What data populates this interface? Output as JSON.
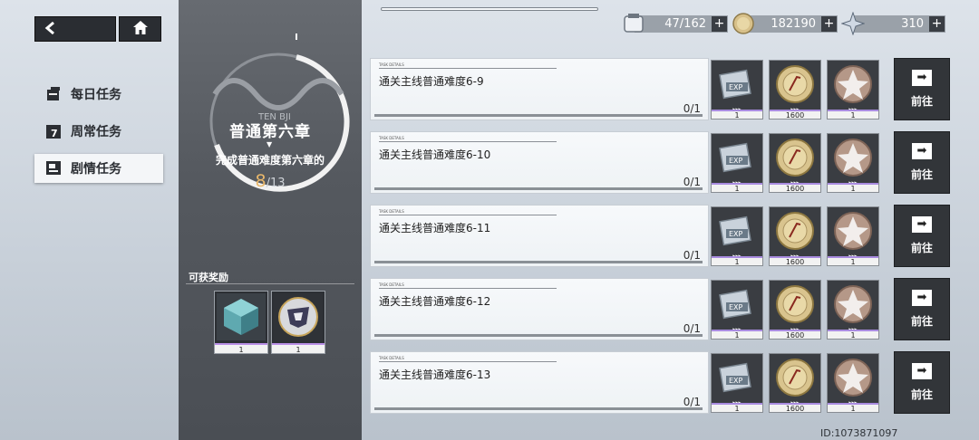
{
  "header": {
    "back_icon": "chevron-left-icon",
    "home_icon": "home-icon"
  },
  "nav": {
    "items": [
      {
        "label": "每日任务",
        "icon": "daily-task-icon",
        "active": false
      },
      {
        "label": "周常任务",
        "icon": "weekly-calendar-icon",
        "active": false
      },
      {
        "label": "剧情任务",
        "icon": "story-task-icon",
        "active": true
      }
    ]
  },
  "chapter": {
    "logo_text": "TEN BJI",
    "title": "普通第六章",
    "description": "完成普通难度第六章的",
    "progress_current": "8",
    "progress_total": "/13",
    "reward_label": "可获奖励",
    "rewards": [
      {
        "icon": "crystal-cube-icon",
        "count": "1"
      },
      {
        "icon": "emblem-badge-icon",
        "count": "1"
      }
    ]
  },
  "resources": [
    {
      "icon": "stamina-icon",
      "value": "47/162"
    },
    {
      "icon": "gold-coin-icon",
      "value": "182190"
    },
    {
      "icon": "star-crystal-icon",
      "value": "310"
    }
  ],
  "tasks": [
    {
      "tag": "TASK DETAILS",
      "name": "通关主线普通难度6-9",
      "progress": "0/1",
      "progress_fraction": 0
    },
    {
      "tag": "TASK DETAILS",
      "name": "通关主线普通难度6-10",
      "progress": "0/1",
      "progress_fraction": 0
    },
    {
      "tag": "TASK DETAILS",
      "name": "通关主线普通难度6-11",
      "progress": "0/1",
      "progress_fraction": 0
    },
    {
      "tag": "TASK DETAILS",
      "name": "通关主线普通难度6-12",
      "progress": "0/1",
      "progress_fraction": 0
    },
    {
      "tag": "TASK DETAILS",
      "name": "通关主线普通难度6-13",
      "progress": "0/1",
      "progress_fraction": 0
    }
  ],
  "task_rewards": [
    {
      "icon": "exp-book-icon",
      "count": "1"
    },
    {
      "icon": "gold-coin-icon",
      "count": "1600"
    },
    {
      "icon": "rank-emblem-icon",
      "count": "1"
    }
  ],
  "go_label": "前往",
  "user_id": "ID:1073871097",
  "colors": {
    "progress_accent": "#e9b86b",
    "rarity_bar": "#a98be0",
    "panel_dark": "#55595f"
  }
}
